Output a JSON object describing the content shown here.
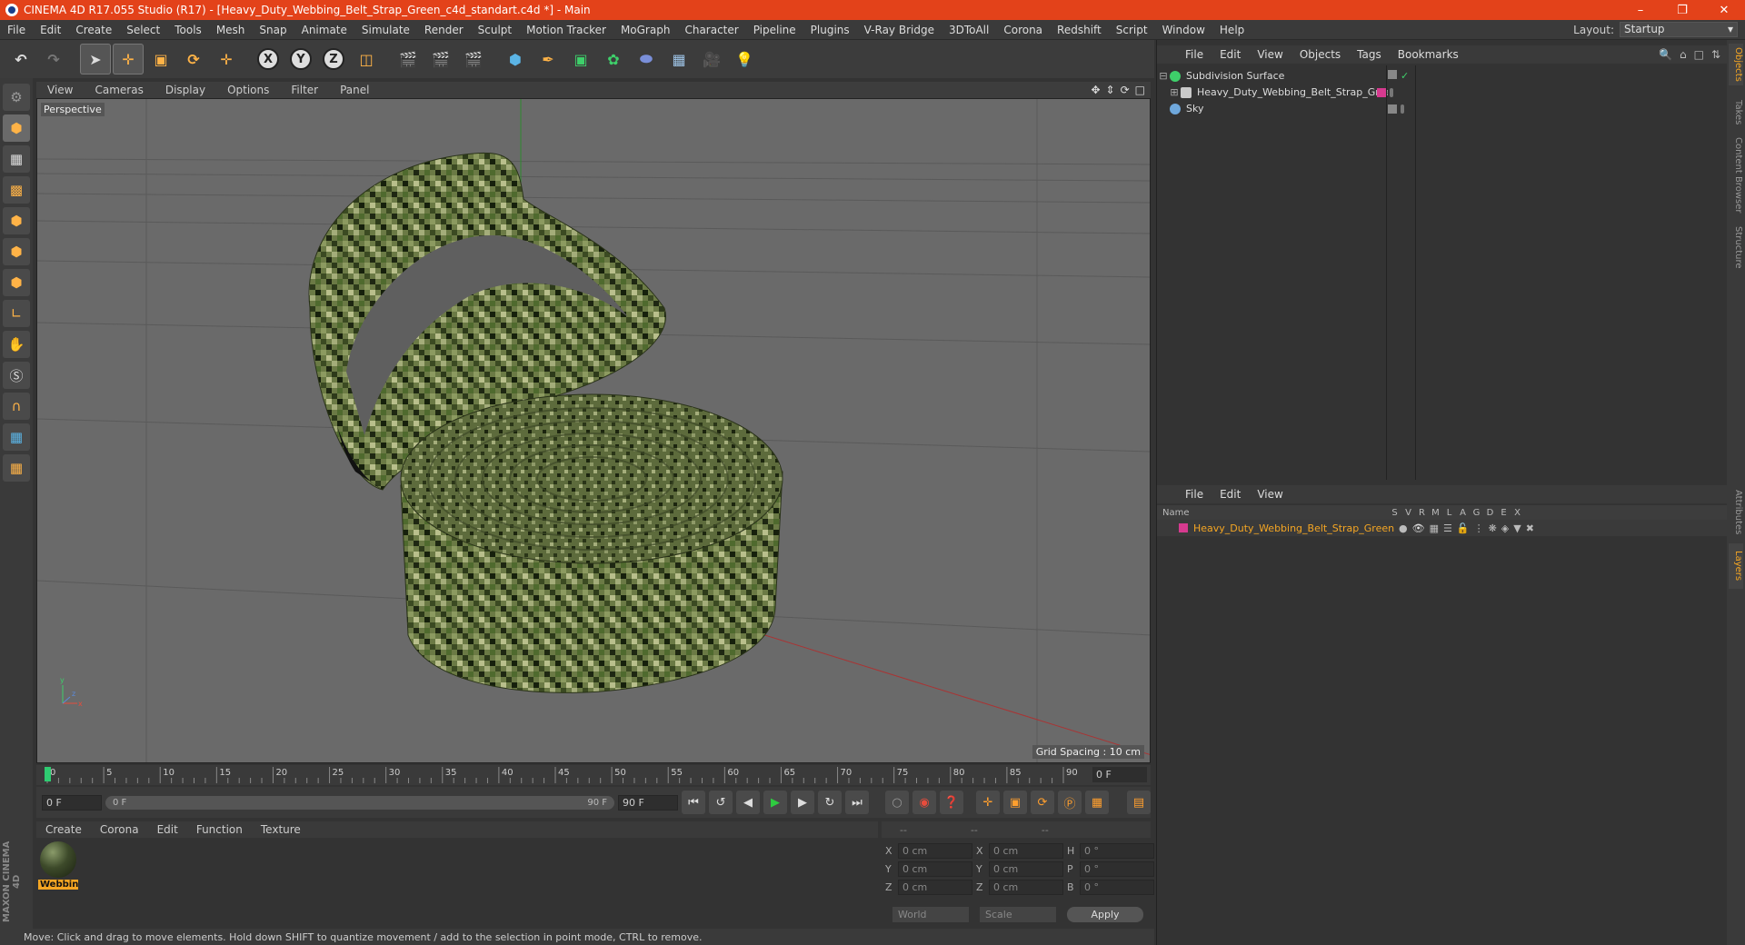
{
  "window": {
    "title": "CINEMA 4D R17.055 Studio (R17) - [Heavy_Duty_Webbing_Belt_Strap_Green_c4d_standart.c4d *] - Main"
  },
  "menubar": {
    "items": [
      "File",
      "Edit",
      "Create",
      "Select",
      "Tools",
      "Mesh",
      "Snap",
      "Animate",
      "Simulate",
      "Render",
      "Sculpt",
      "Motion Tracker",
      "MoGraph",
      "Character",
      "Pipeline",
      "Plugins",
      "V-Ray Bridge",
      "3DToAll",
      "Corona",
      "Redshift",
      "Script",
      "Window",
      "Help"
    ],
    "layout_label": "Layout:",
    "layout_value": "Startup"
  },
  "toolbar": {
    "axis_x": "X",
    "axis_y": "Y",
    "axis_z": "Z"
  },
  "viewport": {
    "menu": [
      "View",
      "Cameras",
      "Display",
      "Options",
      "Filter",
      "Panel"
    ],
    "label": "Perspective",
    "grid_spacing": "Grid Spacing : 10 cm"
  },
  "timeline": {
    "ticks": [
      "0",
      "5",
      "10",
      "15",
      "20",
      "25",
      "30",
      "35",
      "40",
      "45",
      "50",
      "55",
      "60",
      "65",
      "70",
      "75",
      "80",
      "85",
      "90"
    ],
    "frame_field": "0 F",
    "start_field": "0 F",
    "slider_start": "0 F",
    "slider_end": "90 F",
    "end_field": "90 F"
  },
  "material_manager": {
    "menu": [
      "Create",
      "Corona",
      "Edit",
      "Function",
      "Texture"
    ],
    "materials": [
      {
        "name": "Webbin"
      }
    ]
  },
  "coordinates": {
    "headers": [
      "--",
      "--",
      "--"
    ],
    "rows": [
      {
        "a_label": "X",
        "a_value": "0 cm",
        "b_label": "X",
        "b_value": "0 cm",
        "c_label": "H",
        "c_value": "0 °"
      },
      {
        "a_label": "Y",
        "a_value": "0 cm",
        "b_label": "Y",
        "b_value": "0 cm",
        "c_label": "P",
        "c_value": "0 °"
      },
      {
        "a_label": "Z",
        "a_value": "0 cm",
        "b_label": "Z",
        "b_value": "0 cm",
        "c_label": "B",
        "c_value": "0 °"
      }
    ],
    "space_select": "World",
    "mode_select": "Scale",
    "apply_label": "Apply"
  },
  "statusbar": {
    "text": "Move: Click and drag to move elements. Hold down SHIFT to quantize movement / add to the selection in point mode, CTRL to remove."
  },
  "object_manager": {
    "menu": [
      "File",
      "Edit",
      "View",
      "Objects",
      "Tags",
      "Bookmarks"
    ],
    "objects": [
      {
        "name": "Subdivision Surface",
        "icon_color": "#3ecf6a"
      },
      {
        "name": "Heavy_Duty_Webbing_Belt_Strap_Green",
        "icon_color": "#c9c9c9"
      },
      {
        "name": "Sky",
        "icon_color": "#6fa8dc"
      }
    ]
  },
  "layer_manager": {
    "menu": [
      "File",
      "Edit",
      "View"
    ],
    "columns": [
      "Name",
      "S",
      "V",
      "R",
      "M",
      "L",
      "A",
      "G",
      "D",
      "E",
      "X"
    ],
    "layers": [
      {
        "name": "Heavy_Duty_Webbing_Belt_Strap_Green",
        "color": "#d63a8f"
      }
    ]
  },
  "side_tabs": [
    "Objects",
    "Takes",
    "Content Browser",
    "Structure",
    "Attributes",
    "Layers"
  ],
  "brand": "MAXON CINEMA 4D"
}
